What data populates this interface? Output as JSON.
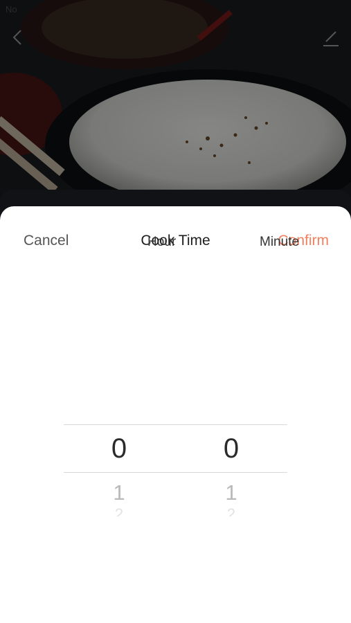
{
  "status": {
    "text": "No"
  },
  "icons": {
    "back": "chevron-left-icon",
    "edit": "pencil-icon"
  },
  "dialog": {
    "cancel_label": "Cancel",
    "title": "Cook Time",
    "confirm_label": "Confirm",
    "accent_color": "#f08060"
  },
  "picker": {
    "hour": {
      "selected": "0",
      "next": "1",
      "next2": "2",
      "unit": "Hour"
    },
    "minute": {
      "selected": "0",
      "next": "1",
      "next2": "2",
      "unit": "Minute"
    }
  }
}
